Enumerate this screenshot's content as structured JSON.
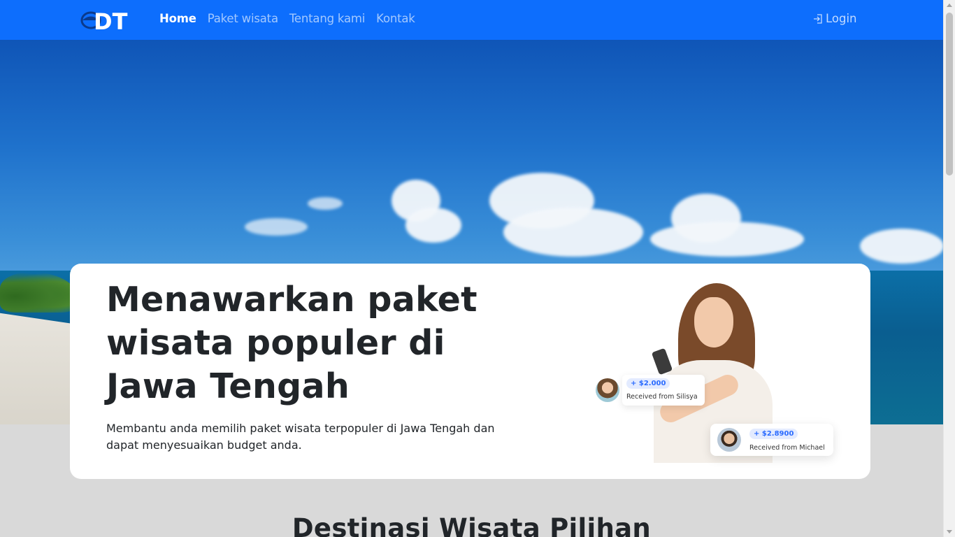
{
  "navbar": {
    "bg_color": "#0d6efd",
    "logo_text": "DT",
    "links": [
      {
        "label": "Home",
        "active": true
      },
      {
        "label": "Paket wisata",
        "active": false
      },
      {
        "label": "Tentang kami",
        "active": false
      },
      {
        "label": "Kontak",
        "active": false
      }
    ],
    "login_label": "Login",
    "login_icon": "login-icon"
  },
  "hero": {
    "title_line1": "Menawarkan paket",
    "title_line2": "wisata populer di",
    "title_line3": "Jawa Tengah",
    "description": "Membantu anda memilih paket wisata terpopuler di Jawa Tengah dan dapat menyesuaikan budget anda.",
    "receipts": [
      {
        "amount": "+ $2.000",
        "label": "Received from Silisya"
      },
      {
        "amount": "+ $2.8900",
        "label": "Received from Michael"
      }
    ]
  },
  "section": {
    "title": "Destinasi Wisata Pilihan"
  }
}
